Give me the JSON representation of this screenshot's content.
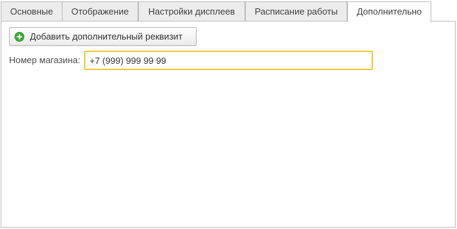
{
  "tabs": [
    {
      "label": "Основные",
      "active": false
    },
    {
      "label": "Отображение",
      "active": false
    },
    {
      "label": "Настройки дисплеев",
      "active": false
    },
    {
      "label": "Расписание работы",
      "active": false
    },
    {
      "label": "Дополнительно",
      "active": true
    }
  ],
  "toolbar": {
    "add_button_label": "Добавить дополнительный реквизит",
    "add_button_icon": "plus-circle-icon",
    "icon_color": "#3cae3c"
  },
  "form": {
    "store_number_label": "Номер магазина:",
    "store_number_value": "+7 (999) 999 99 99"
  },
  "colors": {
    "focus_border": "#f0c93a",
    "tab_inactive_bg": "#ececec",
    "border": "#bdbdbd"
  }
}
